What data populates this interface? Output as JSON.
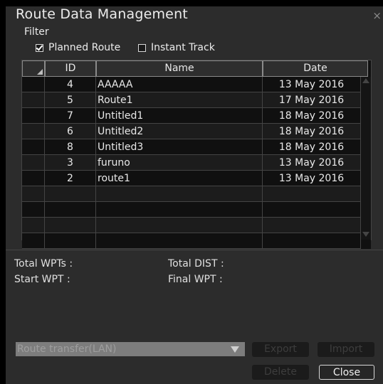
{
  "window": {
    "title": "Route Data Management",
    "close_glyph": "×"
  },
  "filter": {
    "label": "Filter",
    "planned_route": {
      "label": "Planned Route",
      "checked": true
    },
    "instant_track": {
      "label": "Instant Track",
      "checked": false
    }
  },
  "table": {
    "columns": [
      "ID",
      "Name",
      "Date"
    ],
    "rows": [
      {
        "id": "4",
        "name": "AAAAA",
        "date": "13 May 2016"
      },
      {
        "id": "5",
        "name": "Route1",
        "date": "17 May 2016"
      },
      {
        "id": "7",
        "name": "Untitled1",
        "date": "18 May 2016"
      },
      {
        "id": "6",
        "name": "Untitled2",
        "date": "18 May 2016"
      },
      {
        "id": "8",
        "name": "Untitled3",
        "date": "18 May 2016"
      },
      {
        "id": "3",
        "name": "furuno",
        "date": "13 May 2016"
      },
      {
        "id": "2",
        "name": "route1",
        "date": "13 May 2016"
      }
    ],
    "empty_rows": 4
  },
  "info": {
    "total_wpts": "Total WPTs :",
    "total_dist": "Total DIST :",
    "start_wpt": "Start WPT :",
    "final_wpt": "Final WPT :"
  },
  "transfer": {
    "selected": "Route transfer(LAN)"
  },
  "buttons": {
    "export": "Export",
    "import": "Import",
    "delete": "Delete",
    "close": "Close"
  },
  "colors": {
    "window_bg": "#2c2c2c",
    "row_dark": "#101010",
    "row_alt": "#1c1c1c",
    "text": "#e8e8e8",
    "disabled_text": "#3d3d3d"
  }
}
